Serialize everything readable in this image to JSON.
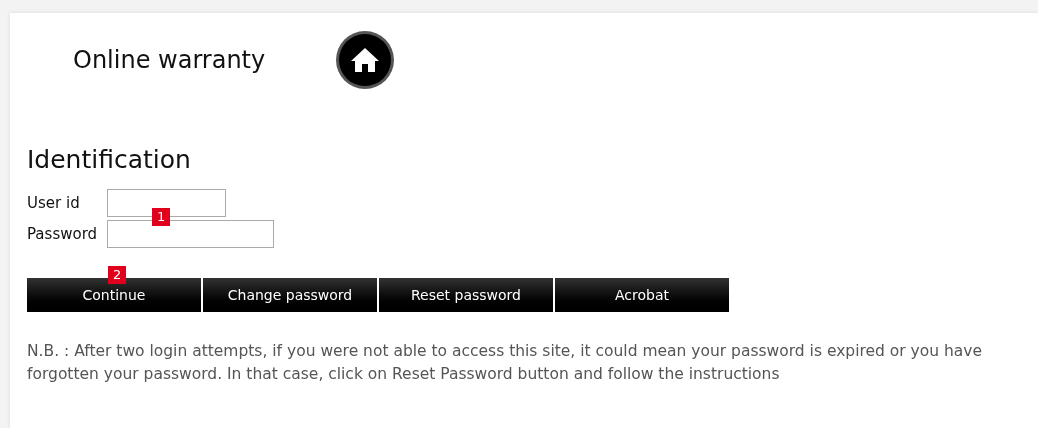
{
  "header": {
    "title": "Online warranty"
  },
  "form": {
    "heading": "Identification",
    "fields": [
      {
        "label": "User id",
        "marker": "1"
      },
      {
        "label": "Password"
      }
    ]
  },
  "buttons": [
    {
      "label": "Continue",
      "marker": "2"
    },
    {
      "label": "Change password"
    },
    {
      "label": "Reset password"
    },
    {
      "label": "Acrobat"
    }
  ],
  "note": "N.B. : After two login attempts, if you were not able to access this site, it could mean your password is expired or you have forgotten your password. In that case, click on Reset Password button and follow the instructions"
}
